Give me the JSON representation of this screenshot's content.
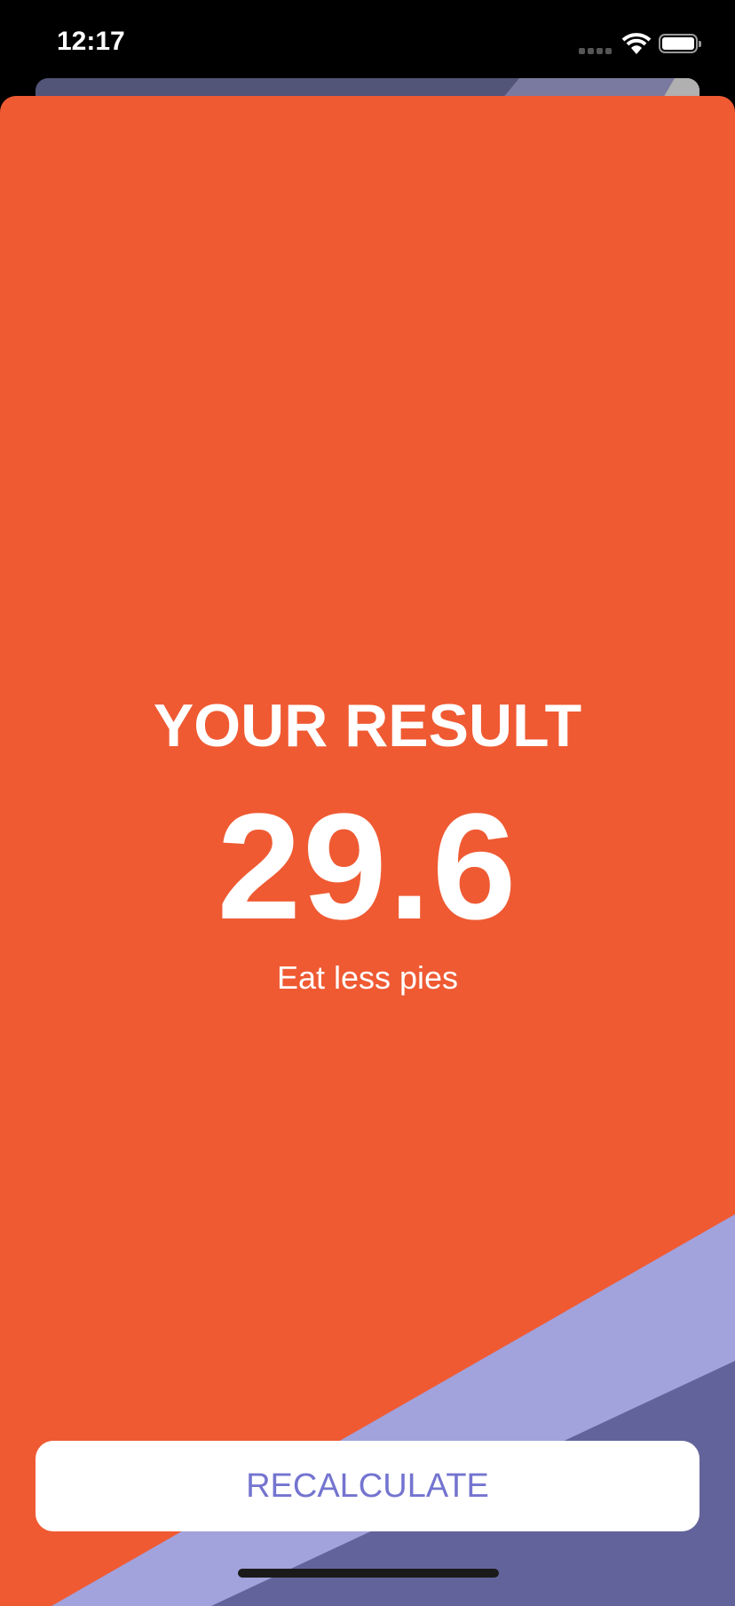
{
  "status_bar": {
    "time": "12:17"
  },
  "result": {
    "title": "YOUR RESULT",
    "value": "29.6",
    "advice": "Eat less pies"
  },
  "recalculate_label": "RECALCULATE",
  "colors": {
    "background": "#ef5a33",
    "accent": "#7474d0",
    "stripe_light": "#a2a2dc",
    "stripe_dark": "#63639b"
  }
}
